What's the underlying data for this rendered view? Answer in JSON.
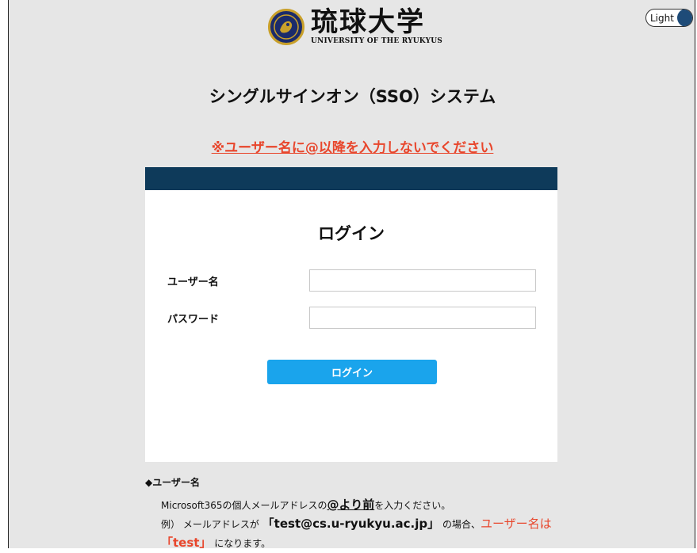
{
  "theme_toggle": {
    "label": "Light",
    "knob_color": "#1e4b78"
  },
  "logo": {
    "kanji": "琉球大学",
    "english": "UNIVERSITY OF THE RYUKYUS"
  },
  "system_title": "シングルサインオン（SSO）システム",
  "warning": "※ユーザー名に@以降を入力しないでください",
  "login_panel": {
    "title": "ログイン",
    "header_bar_color": "#0e3a5a",
    "username_label": "ユーザー名",
    "username_value": "",
    "password_label": "パスワード",
    "password_value": "",
    "login_button": "ログイン",
    "button_color": "#1aa4ec"
  },
  "username_note": {
    "heading": "◆ユーザー名",
    "line1_prefix": "Microsoft365の個人メールアドレスの",
    "line1_emph": "@より前",
    "line1_suffix": "を入力ください。",
    "line2_prefix": "例）  メールアドレスが",
    "line2_bracket_open": "「",
    "line2_email": "test@cs.u-ryukyu.ac.jp",
    "line2_bracket_close": "」",
    "line2_suffix": "の場合、",
    "line2_red": "ユーザー名は",
    "line3_red": "「test」",
    "line3_suffix": "になります。"
  },
  "colors": {
    "page_background": "#e6e6e6",
    "warning_red": "#e8462c"
  }
}
